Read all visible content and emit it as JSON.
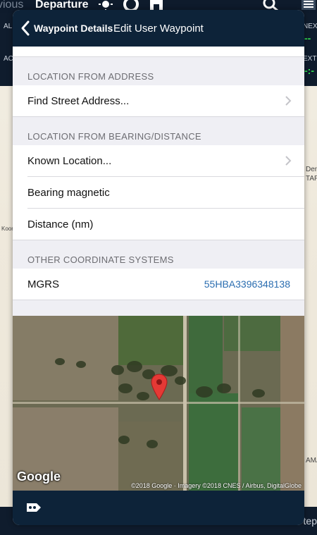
{
  "background_app": {
    "prev_label": "vious",
    "departure_label": "Departure",
    "left_labels": [
      "AL",
      "AC"
    ],
    "right_labels": [
      "NEX",
      "EXT"
    ],
    "right_bottom_label": "tep",
    "map_labels": [
      "Den",
      "TAF",
      "Koon",
      "AMA"
    ]
  },
  "nav": {
    "back_label": "Waypoint Details",
    "title": "Edit User Waypoint"
  },
  "sections": {
    "address": {
      "header": "LOCATION FROM ADDRESS",
      "find_street": "Find Street Address..."
    },
    "bearing": {
      "header": "LOCATION FROM BEARING/DISTANCE",
      "known_location": "Known Location...",
      "bearing_magnetic": "Bearing magnetic",
      "distance": "Distance (nm)"
    },
    "other": {
      "header": "OTHER COORDINATE SYSTEMS",
      "mgrs_label": "MGRS",
      "mgrs_value": "55HBA3396348138"
    }
  },
  "map": {
    "logo": "Google",
    "attribution": "©2018 Google · Imagery ©2018 CNES / Airbus, DigitalGlobe"
  },
  "colors": {
    "nav_bg": "#0d2339",
    "link_blue": "#2a6db0",
    "pin_red": "#e53935",
    "ui_green": "#30e050"
  },
  "icons": [
    "back-chevron-icon",
    "chevron-right-icon",
    "map-pin-icon",
    "route-tool-icon",
    "search-icon",
    "sun-icon",
    "lifebuoy-icon",
    "menu-icon"
  ]
}
